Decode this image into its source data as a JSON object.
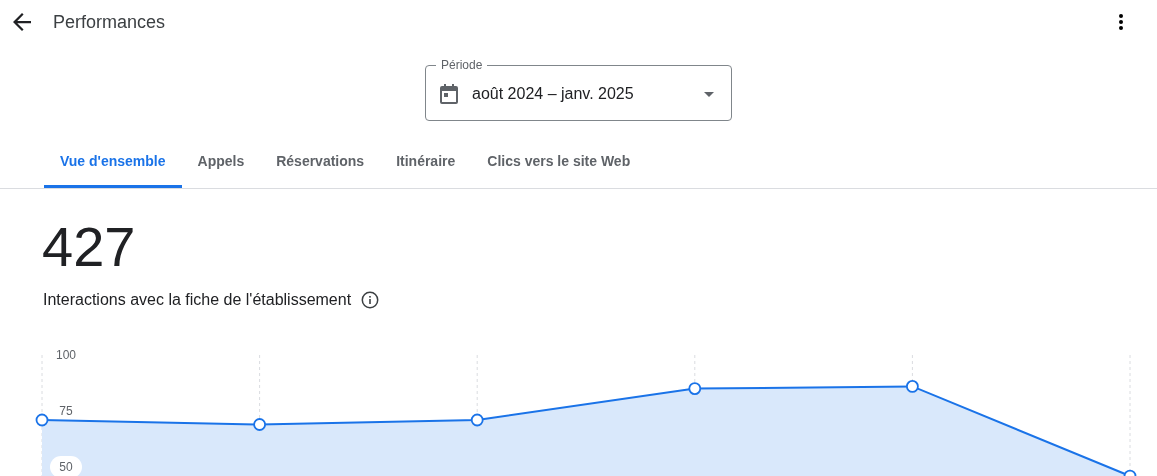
{
  "header": {
    "title": "Performances"
  },
  "period": {
    "label": "Période",
    "value": "août 2024 – janv. 2025"
  },
  "tabs": [
    {
      "label": "Vue d'ensemble",
      "selected": true
    },
    {
      "label": "Appels",
      "selected": false
    },
    {
      "label": "Réservations",
      "selected": false
    },
    {
      "label": "Itinéraire",
      "selected": false
    },
    {
      "label": "Clics vers le site Web",
      "selected": false
    }
  ],
  "summary": {
    "value": "427",
    "label": "Interactions avec la fiche de l'établissement"
  },
  "chart": {
    "chart_data": {
      "type": "area",
      "ylim": [
        42,
        100
      ],
      "yticks": [
        50,
        75,
        100
      ],
      "grid": true,
      "series": [
        {
          "color": "#1a73e8",
          "values": [
            71,
            69,
            71,
            85,
            86,
            46
          ]
        }
      ]
    }
  }
}
